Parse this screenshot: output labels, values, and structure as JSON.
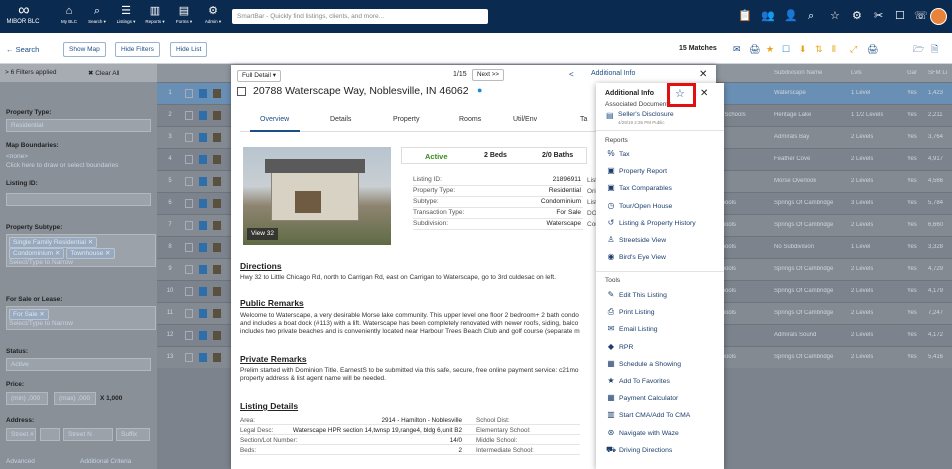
{
  "topbar": {
    "logo_mark": "∞",
    "logo_text": "MIBOR BLC",
    "nav": [
      {
        "icon": "⌂",
        "label": "My BLC"
      },
      {
        "icon": "⌕",
        "label": "Search ▾"
      },
      {
        "icon": "☰",
        "label": "Listings ▾"
      },
      {
        "icon": "▥",
        "label": "Reports ▾"
      },
      {
        "icon": "▤",
        "label": "Forms ▾"
      },
      {
        "icon": "⚙",
        "label": "Admin ▾"
      }
    ],
    "smartbar_placeholder": "SmartBar - Quickly find listings, clients, and more...",
    "right_icons": [
      "📋",
      "👥",
      "👤",
      "⌕",
      "☆",
      "⚙",
      "✂",
      "☐",
      "☏"
    ]
  },
  "toolbar": {
    "search_label": "← Search",
    "show_map": "Show Map",
    "hide_filters": "Hide Filters",
    "hide_list": "Hide List",
    "matches": "15 Matches",
    "icons": [
      "✉",
      "🖨",
      "★",
      "☐",
      "⬇",
      "⇅",
      "⫴",
      "⤢",
      "🖨",
      "🗁",
      "🗎"
    ]
  },
  "filters": {
    "applied": "> 6 Filters applied",
    "clear_all": "✖ Clear All",
    "property_type_label": "Property Type:",
    "property_type_value": "Residential",
    "map_boundaries_label": "Map Boundaries:",
    "map_none": "<none>",
    "map_hint": "Click here to draw or select boundaries",
    "listing_id_label": "Listing ID:",
    "subtype_label": "Property Subtype:",
    "subtype_chips": [
      "Single Family Residential ✕",
      "Condominium ✕",
      "Townhouse ✕"
    ],
    "subtype_placeholder": "Select/Type to Narrow",
    "sale_lease_label": "For Sale or Lease:",
    "sale_chip": "For Sale ✕",
    "sale_placeholder": "Select/Type to Narrow",
    "status_label": "Status:",
    "status_value": "Active",
    "price_label": "Price:",
    "price_min": "(min) ,000",
    "price_max": "(max) ,000",
    "price_multiplier": "X 1,000",
    "address_label": "Address:",
    "street_placeholder": "Street #",
    "street_name_placeholder": "Street N",
    "suffix_placeholder": "Suffix",
    "advanced": "Advanced",
    "additional_criteria": "Additional Criteria"
  },
  "table": {
    "headers": [
      "Subdivision Name",
      "Lvls",
      "Gar",
      "SFM Li"
    ],
    "rows": [
      {
        "num": "1",
        "area": "",
        "sub": "Waterscape",
        "lvls": "1 Level",
        "gar": "Yes",
        "sf": "1,423"
      },
      {
        "num": "2",
        "area": "ounty Schools",
        "sub": "Heritage Lake",
        "lvls": "1 1/2 Levels",
        "gar": "Yes",
        "sf": "2,211"
      },
      {
        "num": "3",
        "area": "ship",
        "sub": "Admirals Bay",
        "lvls": "2 Levels",
        "gar": "Yes",
        "sf": "3,764"
      },
      {
        "num": "4",
        "area": "ship",
        "sub": "Feather Cove",
        "lvls": "2 Levels",
        "gar": "Yes",
        "sf": "4,917"
      },
      {
        "num": "5",
        "area": "",
        "sub": "Morse Overlook",
        "lvls": "2 Levels",
        "gar": "Yes",
        "sf": "4,566"
      },
      {
        "num": "6",
        "area": "m Schools",
        "sub": "Springs Of Cambridge",
        "lvls": "3 Levels",
        "gar": "Yes",
        "sf": "5,784"
      },
      {
        "num": "7",
        "area": "m Schools",
        "sub": "Springs Of Cambridge",
        "lvls": "2 Levels",
        "gar": "Yes",
        "sf": "6,660"
      },
      {
        "num": "8",
        "area": "m Schools",
        "sub": "No Subdivision",
        "lvls": "1 Level",
        "gar": "Yes",
        "sf": "3,328"
      },
      {
        "num": "9",
        "area": "m Schools",
        "sub": "Springs Of Cambridge",
        "lvls": "2 Levels",
        "gar": "Yes",
        "sf": "4,729"
      },
      {
        "num": "10",
        "area": "m Schools",
        "sub": "Springs Of Cambridge",
        "lvls": "2 Levels",
        "gar": "Yes",
        "sf": "4,179"
      },
      {
        "num": "11",
        "area": "m Schools",
        "sub": "Springs Of Cambridge",
        "lvls": "2 Levels",
        "gar": "Yes",
        "sf": "7,247"
      },
      {
        "num": "12",
        "area": "ship",
        "sub": "Admirals Sound",
        "lvls": "2 Levels",
        "gar": "Yes",
        "sf": "4,172"
      },
      {
        "num": "13",
        "area": "m Schools",
        "sub": "Springs Of Cambridge",
        "lvls": "2 Levels",
        "gar": "Yes",
        "sf": "5,416"
      }
    ]
  },
  "listing": {
    "view_label": "Full Detail ▾",
    "pager": "1/15",
    "next": "Next >>",
    "additional_info_link": "Additional Info",
    "address": "20788 Waterscape Way, Noblesville, IN 46062",
    "tabs": [
      "Overview",
      "Details",
      "Property",
      "Rooms",
      "Util/Env",
      "Ta"
    ],
    "photo_label": "View 32",
    "status": "Active",
    "beds": "2 Beds",
    "baths": "2/0 Baths",
    "info": [
      {
        "k": "Listing ID:",
        "v": "21896911"
      },
      {
        "k": "Property Type:",
        "v": "Residential"
      },
      {
        "k": "Subtype:",
        "v": "Condominium"
      },
      {
        "k": "Transaction Type:",
        "v": "For Sale"
      },
      {
        "k": "Subdivision:",
        "v": "Waterscape"
      }
    ],
    "info2": [
      "List Price:",
      "Orig. List Pr",
      "List Date:",
      "DOM/CDOM",
      "County:"
    ],
    "directions_title": "Directions",
    "directions": "Hwy 32 to Little Chicago Rd, north to Carrigan Rd, east on Carrigan to Waterscape, go to 3rd culdesac on left.",
    "public_remarks_title": "Public Remarks",
    "public_remarks": [
      "Welcome to Waterscape, a very desirable Morse lake community. This upper level one floor 2 bedroom+ 2 bath condo",
      "and includes a boat dock (#113) with a lift. Waterscape has been completely renovated with newer roofs, siding, balco",
      "includes two private beaches and is conveniently located near Harbour Trees Beach Club and golf course (separate m"
    ],
    "private_remarks_title": "Private Remarks",
    "private_remarks": [
      "Prelim started with Dominion Title. EarnestS to be submitted via this safe, secure, free online payment service: c21mo",
      "property address & list agent name will be needed."
    ],
    "listing_details_title": "Listing Details",
    "details": [
      {
        "k": "Area:",
        "v": "2914 - Hamilton - Noblesville",
        "k2": "School Dist:"
      },
      {
        "k": "Legal Desc:",
        "v": "Waterscape HPR section 14,twnsp 19,range4, bldg 6,unit B2",
        "k2": "Elementary School:"
      },
      {
        "k": "Section/Lot Number:",
        "v": "14/0",
        "k2": "Middle School:"
      },
      {
        "k": "Beds:",
        "v": "2",
        "k2": "Intermediate School:"
      }
    ]
  },
  "menu": {
    "title": "Additional Info",
    "assoc_docs": "Associated Documents",
    "doc_name": "Seller's Disclosure",
    "doc_meta": "4/29/19 2:35 PM Public",
    "reports_label": "Reports",
    "reports": [
      {
        "icon": "%",
        "label": "Tax"
      },
      {
        "icon": "▣",
        "label": "Property Report"
      },
      {
        "icon": "▣",
        "label": "Tax Comparables"
      },
      {
        "icon": "◷",
        "label": "Tour/Open House"
      },
      {
        "icon": "↺",
        "label": "Listing & Property History"
      },
      {
        "icon": "♙",
        "label": "Streetside View"
      },
      {
        "icon": "◉",
        "label": "Bird's Eye View"
      }
    ],
    "tools_label": "Tools",
    "tools": [
      {
        "icon": "✎",
        "label": "Edit This Listing"
      },
      {
        "icon": "⎙",
        "label": "Print Listing"
      },
      {
        "icon": "✉",
        "label": "Email Listing"
      },
      {
        "icon": "◆",
        "label": "RPR"
      },
      {
        "icon": "▦",
        "label": "Schedule a Showing"
      },
      {
        "icon": "★",
        "label": "Add To Favorites"
      },
      {
        "icon": "▦",
        "label": "Payment Calculator"
      },
      {
        "icon": "▥",
        "label": "Start CMA/Add To CMA"
      },
      {
        "icon": "⊛",
        "label": "Navigate with Waze"
      },
      {
        "icon": "⛟",
        "label": "Driving Directions"
      }
    ]
  },
  "colors": {
    "topbar": "#0b2a4f",
    "accent": "#1c4f86",
    "highlight": "#e01010",
    "active_status": "#3a8a1f"
  }
}
